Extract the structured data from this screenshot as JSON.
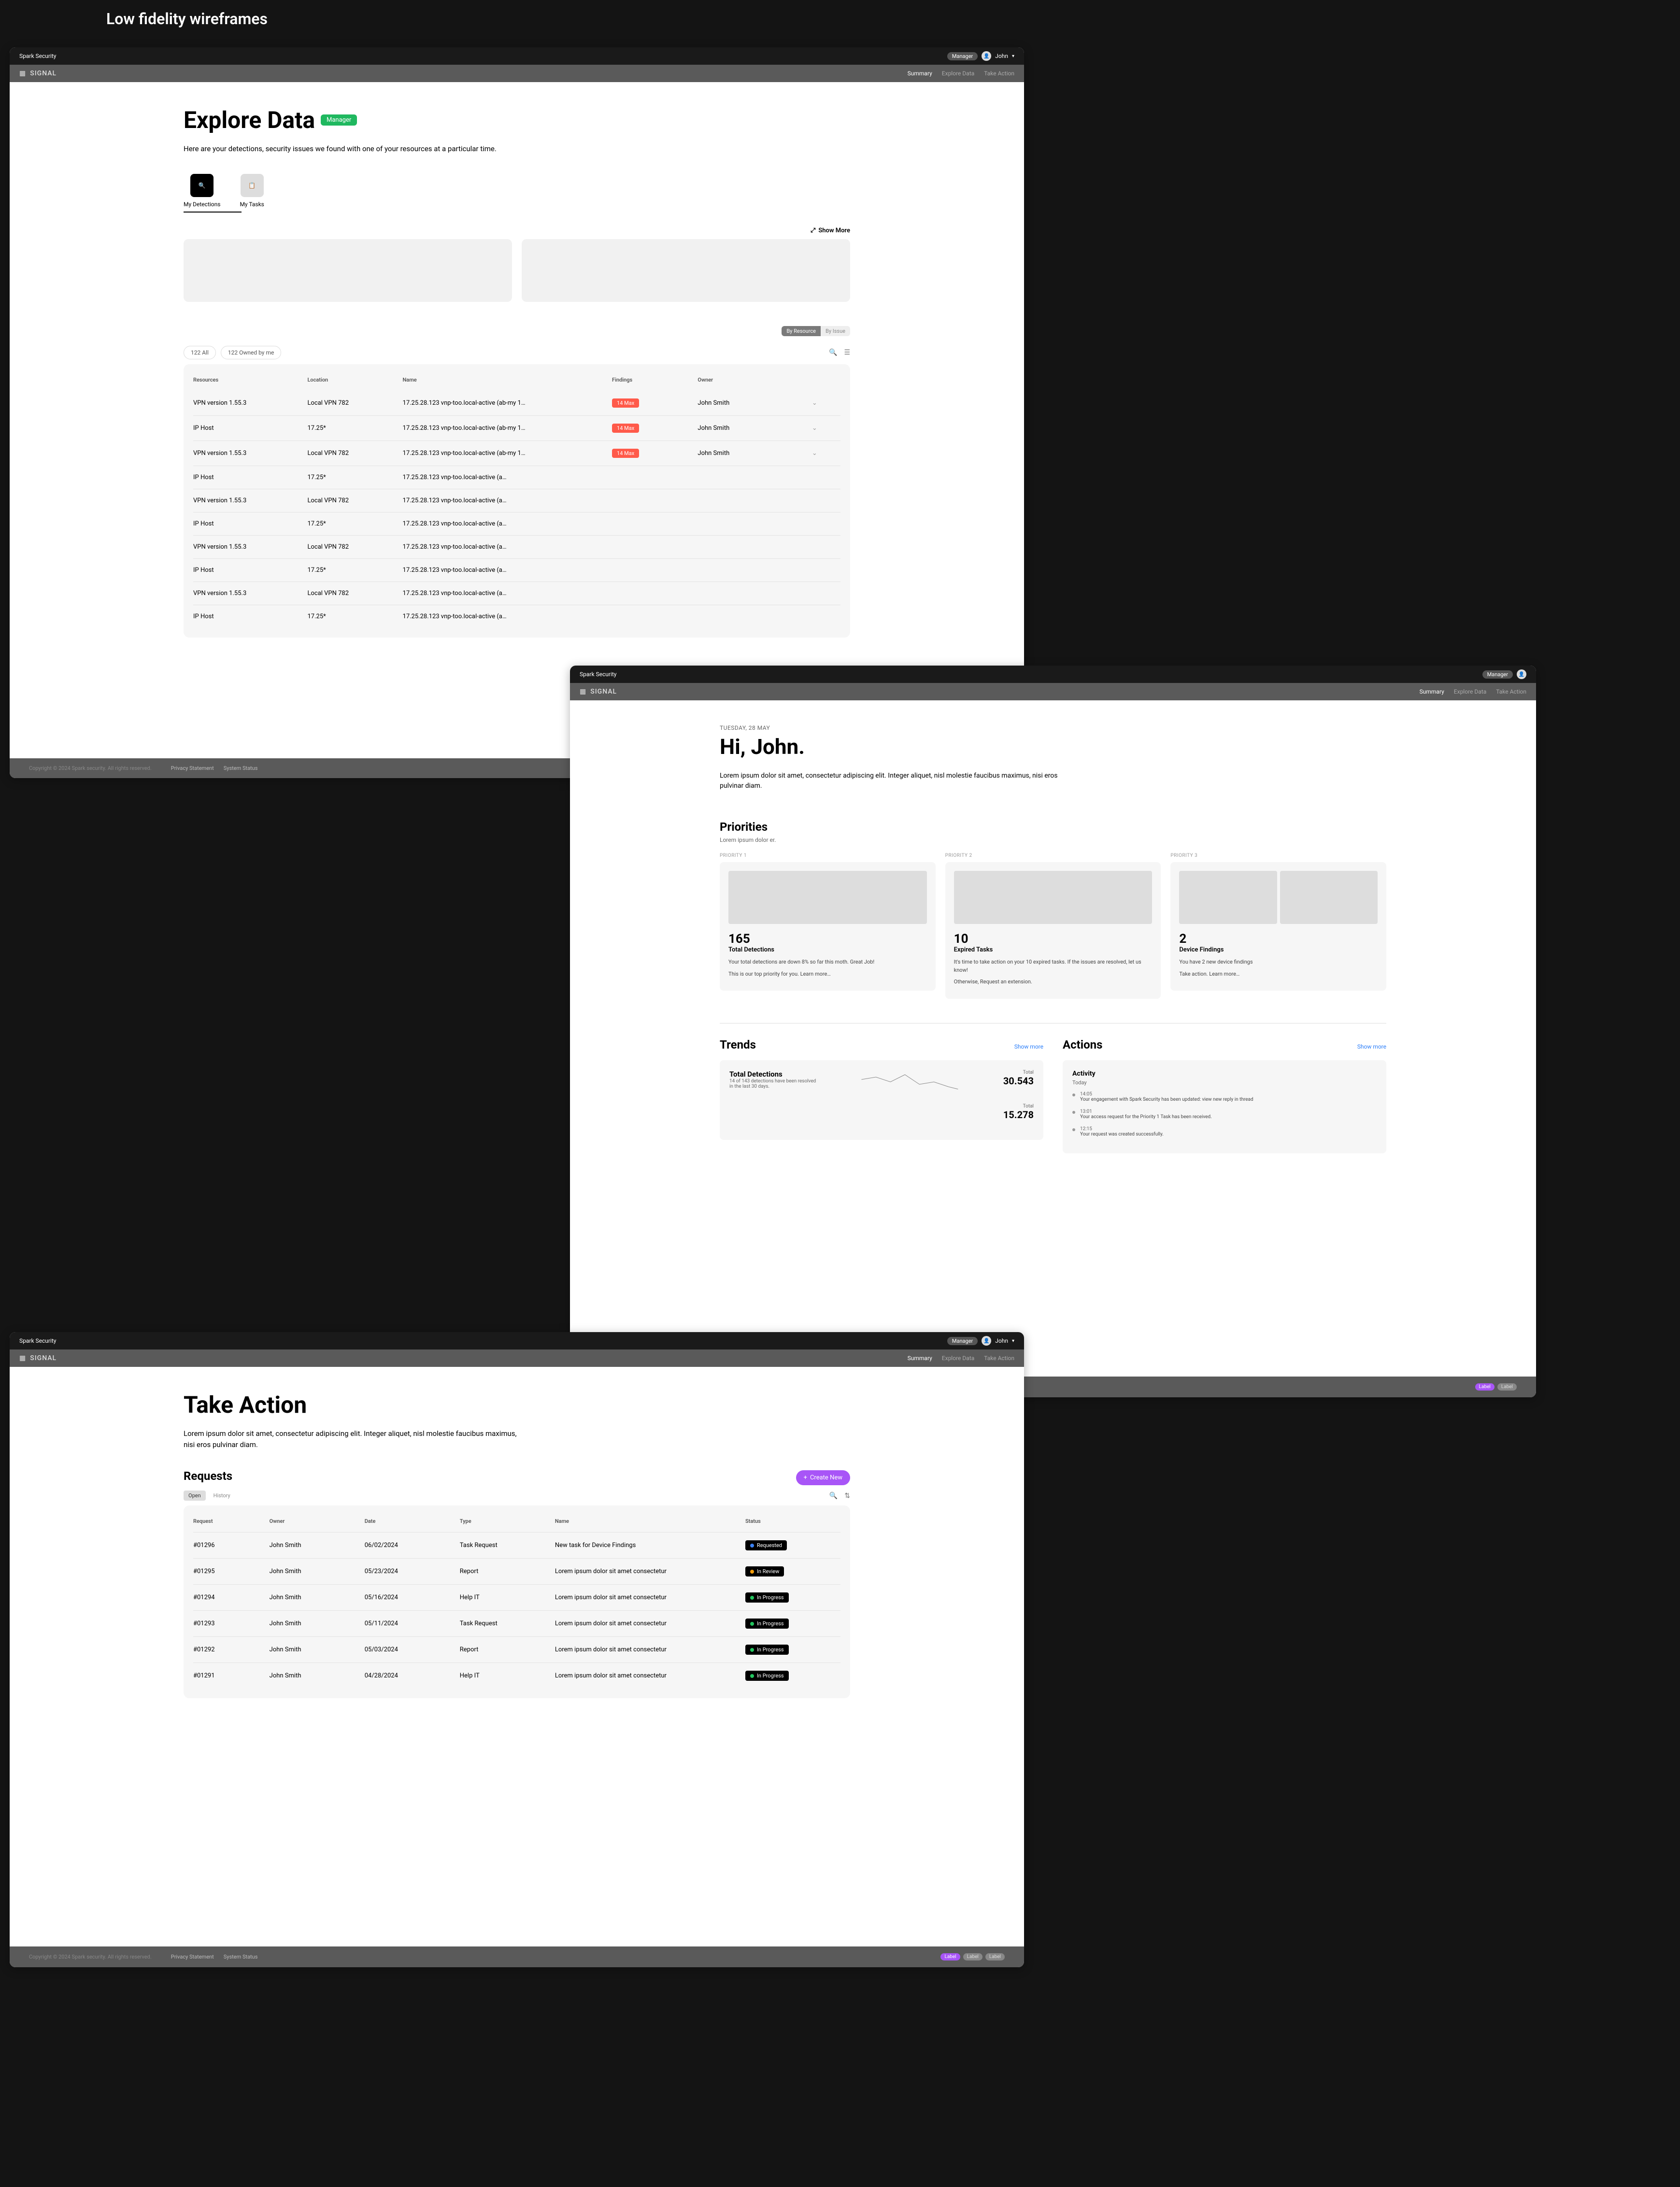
{
  "page_heading": "Low fidelity wireframes",
  "app_name": "Spark Security",
  "brand": "SIGNAL",
  "header": {
    "manager_badge": "Manager",
    "user": "John"
  },
  "nav": {
    "summary": "Summary",
    "explore": "Explore Data",
    "take_action": "Take Action"
  },
  "explore": {
    "title": "Explore Data",
    "badge": "Manager",
    "subtitle": "Here are your detections, security issues we found with one of your resources at a particular time.",
    "tab_detections": "My Detections",
    "tab_tasks": "My Tasks",
    "show_more": "Show More",
    "seg_resource": "By Resource",
    "seg_issue": "By Issue",
    "chip_all": "122 All",
    "chip_owned": "122 Owned by me",
    "columns": {
      "resources": "Resources",
      "location": "Location",
      "name": "Name",
      "findings": "Findings",
      "owner": "Owner"
    },
    "rows": [
      {
        "res": "VPN version 1.55.3",
        "loc": "Local VPN 782",
        "name": "17.25.28.123 vnp-too.local-active (ab-my 1…",
        "find": "14 Max",
        "owner": "John Smith"
      },
      {
        "res": "IP Host",
        "loc": "17.25*",
        "name": "17.25.28.123 vnp-too.local-active (ab-my 1…",
        "find": "14 Max",
        "owner": "John Smith"
      },
      {
        "res": "VPN version 1.55.3",
        "loc": "Local VPN 782",
        "name": "17.25.28.123 vnp-too.local-active (ab-my 1…",
        "find": "14 Max",
        "owner": "John Smith"
      },
      {
        "res": "IP Host",
        "loc": "17.25*",
        "name": "17.25.28.123 vnp-too.local-active (a…",
        "find": "",
        "owner": ""
      },
      {
        "res": "VPN version 1.55.3",
        "loc": "Local VPN 782",
        "name": "17.25.28.123 vnp-too.local-active (a…",
        "find": "",
        "owner": ""
      },
      {
        "res": "IP Host",
        "loc": "17.25*",
        "name": "17.25.28.123 vnp-too.local-active (a…",
        "find": "",
        "owner": ""
      },
      {
        "res": "VPN version 1.55.3",
        "loc": "Local VPN 782",
        "name": "17.25.28.123 vnp-too.local-active (a…",
        "find": "",
        "owner": ""
      },
      {
        "res": "IP Host",
        "loc": "17.25*",
        "name": "17.25.28.123 vnp-too.local-active (a…",
        "find": "",
        "owner": ""
      },
      {
        "res": "VPN version 1.55.3",
        "loc": "Local VPN 782",
        "name": "17.25.28.123 vnp-too.local-active (a…",
        "find": "",
        "owner": ""
      },
      {
        "res": "IP Host",
        "loc": "17.25*",
        "name": "17.25.28.123 vnp-too.local-active (a…",
        "find": "",
        "owner": ""
      }
    ]
  },
  "summary": {
    "date": "TUESDAY, 28 MAY",
    "greeting": "Hi, John.",
    "body": "Lorem ipsum dolor sit amet, consectetur adipiscing elit. Integer aliquet, nisl molestie faucibus maximus, nisi eros pulvinar diam.",
    "priorities_title": "Priorities",
    "priorities_sub": "Lorem ipsum dolor er.",
    "pri_labels": [
      "PRIORITY 1",
      "PRIORITY 2",
      "PRIORITY 3"
    ],
    "cards": [
      {
        "stat": "165",
        "label": "Total Detections",
        "line1": "Your total detections are down 8% so far this moth. Great Job!",
        "line2": "This is our top priority for you. Learn more…"
      },
      {
        "stat": "10",
        "label": "Expired Tasks",
        "line1": "It's time to take action on your 10 expired tasks. If the issues are resolved, let us know!",
        "line2": "Otherwise, Request an extension."
      },
      {
        "stat": "2",
        "label": "Device Findings",
        "line1": "You have 2 new device findings",
        "line2": "Take action. Learn more…"
      }
    ],
    "trends_title": "Trends",
    "actions_title": "Actions",
    "show_more": "Show more",
    "trends": {
      "td_label": "Total Detections",
      "td_sub": "14 of 143 detections have been resolved in the last 30 days.",
      "total_label": "Total",
      "total1": "30.543",
      "total2": "15.278"
    },
    "activity": {
      "title": "Activity",
      "today": "Today",
      "items": [
        {
          "time": "14:05",
          "text": "Your engagement with Spark Security has been updated: view new reply in thread"
        },
        {
          "time": "13:01",
          "text": "Your access request for the Priority 1 Task has been received."
        },
        {
          "time": "12:15",
          "text": "Your request was created successfully."
        }
      ]
    }
  },
  "take_action": {
    "title": "Take Action",
    "subtitle": "Lorem ipsum dolor sit amet, consectetur adipiscing elit. Integer aliquet, nisl molestie faucibus maximus, nisi eros pulvinar diam.",
    "requests": "Requests",
    "create_new": "Create New",
    "tab_open": "Open",
    "tab_history": "History",
    "columns": {
      "request": "Request",
      "owner": "Owner",
      "date": "Date",
      "type": "Type",
      "name": "Name",
      "status": "Status"
    },
    "rows": [
      {
        "id": "#01296",
        "owner": "John Smith",
        "date": "06/02/2024",
        "type": "Task Request",
        "name": "New task for Device Findings",
        "status": "Requested",
        "dot": "blue"
      },
      {
        "id": "#01295",
        "owner": "John Smith",
        "date": "05/23/2024",
        "type": "Report",
        "name": "Lorem ipsum dolor sit amet consectetur",
        "status": "In Review",
        "dot": "orange"
      },
      {
        "id": "#01294",
        "owner": "John Smith",
        "date": "05/16/2024",
        "type": "Help IT",
        "name": "Lorem ipsum dolor sit amet consectetur",
        "status": "In Progress",
        "dot": "green"
      },
      {
        "id": "#01293",
        "owner": "John Smith",
        "date": "05/11/2024",
        "type": "Task Request",
        "name": "Lorem ipsum dolor sit amet consectetur",
        "status": "In Progress",
        "dot": "green"
      },
      {
        "id": "#01292",
        "owner": "John Smith",
        "date": "05/03/2024",
        "type": "Report",
        "name": "Lorem ipsum dolor sit amet consectetur",
        "status": "In Progress",
        "dot": "green"
      },
      {
        "id": "#01291",
        "owner": "John Smith",
        "date": "04/28/2024",
        "type": "Help IT",
        "name": "Lorem ipsum dolor sit amet consectetur",
        "status": "In Progress",
        "dot": "green"
      }
    ]
  },
  "footer": {
    "copyright": "Copyright © 2024 Spark security. All rights reserved.",
    "privacy": "Privacy Statement",
    "system": "System Status",
    "badges": [
      "Label",
      "Label",
      "Label"
    ]
  }
}
